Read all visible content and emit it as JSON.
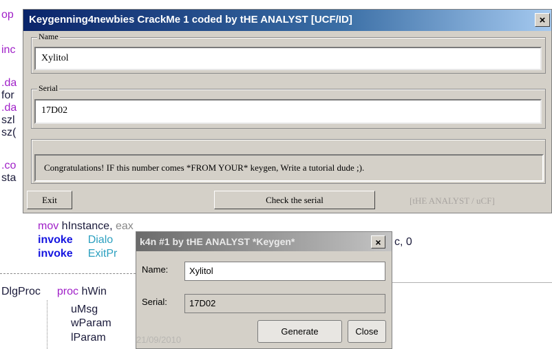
{
  "background_code": {
    "left_fragments": [
      "op",
      "inc",
      ".da",
      "for",
      ".da",
      "szl",
      "sz(",
      ".co",
      "sta"
    ],
    "line_mov": {
      "kw": "mov",
      "text": " hInstance, ",
      "reg": "eax"
    },
    "line_invoke1": {
      "kw": "invoke",
      "text": "Dialo",
      "tail": "c, 0"
    },
    "line_invoke2": {
      "kw": "invoke",
      "text": "ExitPr"
    },
    "proc_line": {
      "label": "DlgProc",
      "kw": "proc",
      "text": " hWin"
    },
    "params": [
      "uMsg",
      "wParam",
      "lParam"
    ]
  },
  "crackme": {
    "title": "Keygenning4newbies CrackMe 1 coded by tHE ANALYST [UCF/ID]",
    "close": "×",
    "name_label": "Name",
    "name_value": "Xylitol",
    "serial_label": "Serial",
    "serial_value": "17D02",
    "message": "Congratulations! IF this number comes *FROM YOUR* keygen, Write a tutorial dude ;).",
    "exit_button": "Exit",
    "check_button": "Check the serial",
    "credit": "[tHE ANALYST / uCF]"
  },
  "keygen": {
    "title": "k4n #1 by tHE ANALYST *Keygen*",
    "close": "×",
    "name_label": "Name:",
    "name_value": "Xylitol",
    "serial_label": "Serial:",
    "serial_value": "17D02",
    "generate_button": "Generate",
    "close_button": "Close",
    "date": "21/09/2010"
  }
}
